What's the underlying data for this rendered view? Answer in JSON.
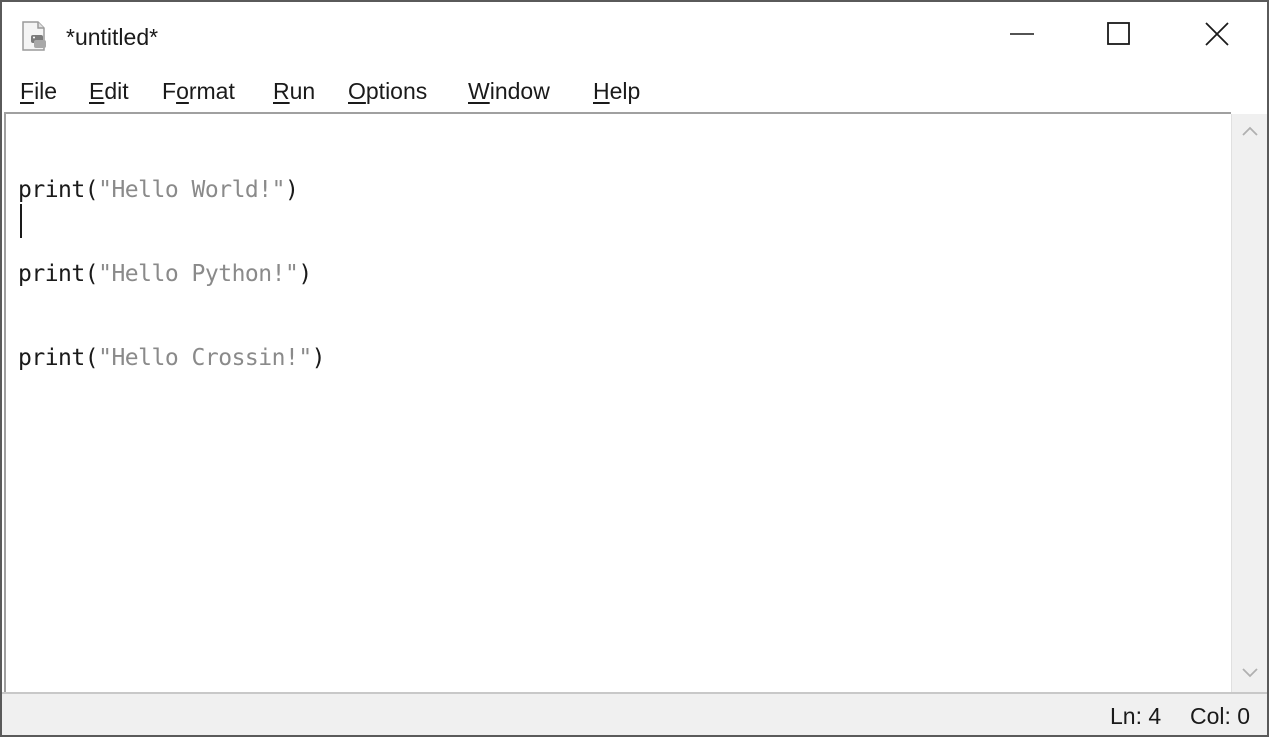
{
  "window": {
    "title": "*untitled*",
    "icon": "python-file-icon"
  },
  "controls": {
    "minimize_icon": "minimize-icon",
    "maximize_icon": "maximize-icon",
    "close_icon": "close-icon"
  },
  "menu": {
    "items": [
      {
        "before": "",
        "key": "F",
        "after": "ile"
      },
      {
        "before": "",
        "key": "E",
        "after": "dit"
      },
      {
        "before": "F",
        "key": "o",
        "after": "rmat"
      },
      {
        "before": "",
        "key": "R",
        "after": "un"
      },
      {
        "before": "",
        "key": "O",
        "after": "ptions"
      },
      {
        "before": "",
        "key": "W",
        "after": "indow"
      },
      {
        "before": "",
        "key": "H",
        "after": "elp"
      }
    ]
  },
  "editor": {
    "lines": [
      {
        "keyword": "print",
        "open": "(",
        "string": "\"Hello World!\"",
        "close": ")"
      },
      {
        "keyword": "print",
        "open": "(",
        "string": "\"Hello Python!\"",
        "close": ")"
      },
      {
        "keyword": "print",
        "open": "(",
        "string": "\"Hello Crossin!\"",
        "close": ")"
      }
    ]
  },
  "status": {
    "ln": "Ln: 4",
    "col": "Col: 0"
  },
  "colors": {
    "keyword": "#1a1a1a",
    "string": "#8a8a8a",
    "statusbar_bg": "#f0f0f0"
  }
}
